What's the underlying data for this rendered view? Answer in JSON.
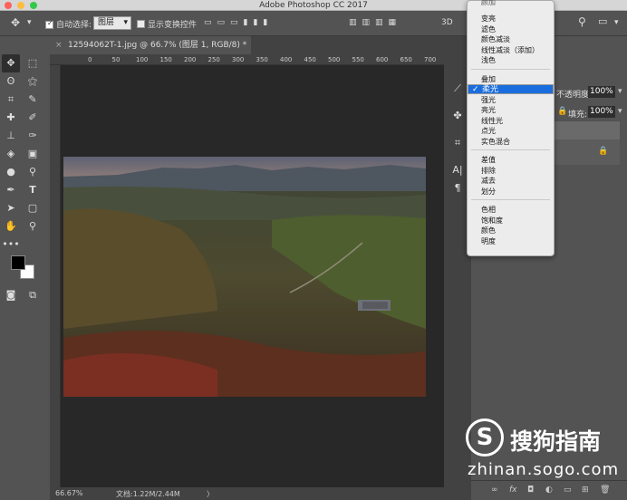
{
  "app": {
    "title": "Adobe Photoshop CC 2017"
  },
  "options": {
    "auto_select_label": "自动选择:",
    "auto_select_value": "图层",
    "show_transform_label": "显示变换控件",
    "mode_3d": "3D"
  },
  "document": {
    "tab_title": "12594062T-1.jpg @ 66.7% (图层 1, RGB/8) *",
    "close": "×"
  },
  "ruler_ticks": [
    "0",
    "50",
    "100",
    "150",
    "200",
    "250",
    "300",
    "350",
    "400",
    "450",
    "500",
    "550",
    "600",
    "650",
    "700",
    "750",
    "8"
  ],
  "status": {
    "zoom": "66.67%",
    "doc": "文档:1.22M/2.44M",
    "arrow": "〉"
  },
  "layers_panel": {
    "opacity_label": "不透明度:",
    "opacity": "100%",
    "fill_label": "填充:",
    "fill": "100%"
  },
  "blend_menu": {
    "partial_top": "颜加",
    "groups": [
      [
        "变亮",
        "滤色",
        "颜色减淡",
        "线性减淡（添加）",
        "浅色"
      ],
      [
        "叠加",
        "柔光",
        "强光",
        "亮光",
        "线性光",
        "点光",
        "实色混合"
      ],
      [
        "差值",
        "排除",
        "减去",
        "划分"
      ],
      [
        "色相",
        "饱和度",
        "颜色",
        "明度"
      ]
    ],
    "selected": "柔光"
  },
  "watermark": {
    "brand": "搜狗指南",
    "url": "zhinan.sogo.com",
    "logo_glyph": "S"
  },
  "colors": {
    "menu_highlight": "#1a6ddc",
    "canvas_bg": "#282828",
    "panel_bg": "#535353"
  },
  "icons": [
    "move-icon",
    "marquee-icon",
    "lasso-icon",
    "magic-wand-icon",
    "crop-icon",
    "eyedropper-icon",
    "healing-icon",
    "brush-icon",
    "stamp-icon",
    "history-brush-icon",
    "eraser-icon",
    "gradient-icon",
    "blur-icon",
    "dodge-icon",
    "pen-icon",
    "type-icon",
    "path-select-icon",
    "shape-icon",
    "hand-icon",
    "zoom-icon",
    "more-icon",
    "fg-bg-color-icon",
    "quickmask-icon",
    "screen-mode-icon"
  ]
}
